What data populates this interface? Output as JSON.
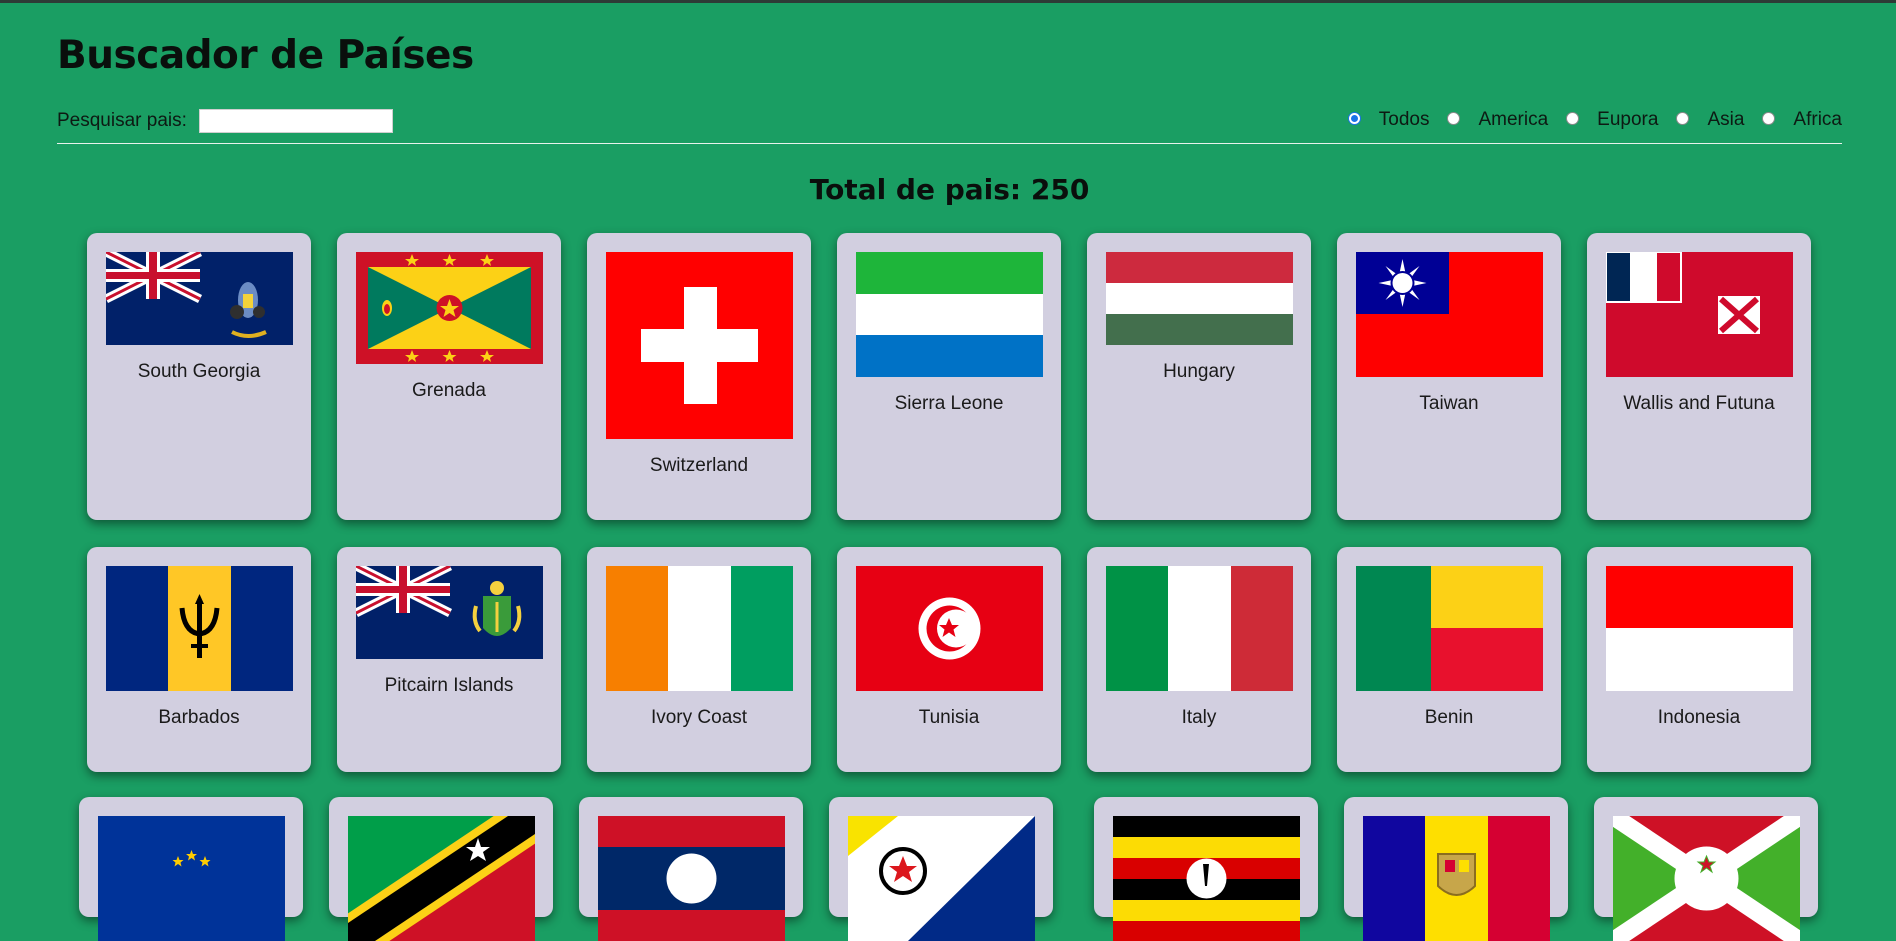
{
  "header": {
    "title": "Buscador de Países"
  },
  "search": {
    "label": "Pesquisar pais:",
    "value": "",
    "placeholder": ""
  },
  "filters": [
    {
      "label": "Todos",
      "checked": true
    },
    {
      "label": "America",
      "checked": false
    },
    {
      "label": "Eupora",
      "checked": false
    },
    {
      "label": "Asia",
      "checked": false
    },
    {
      "label": "Africa",
      "checked": false
    }
  ],
  "total": {
    "text": "Total de pais: 250"
  },
  "countries": [
    {
      "name": "South Georgia",
      "flag": "south-georgia-flag"
    },
    {
      "name": "Grenada",
      "flag": "grenada-flag"
    },
    {
      "name": "Switzerland",
      "flag": "switzerland-flag"
    },
    {
      "name": "Sierra Leone",
      "flag": "sierra-leone-flag"
    },
    {
      "name": "Hungary",
      "flag": "hungary-flag"
    },
    {
      "name": "Taiwan",
      "flag": "taiwan-flag"
    },
    {
      "name": "Wallis and Futuna",
      "flag": "wallis-futuna-flag"
    },
    {
      "name": "Barbados",
      "flag": "barbados-flag"
    },
    {
      "name": "Pitcairn Islands",
      "flag": "pitcairn-flag"
    },
    {
      "name": "Ivory Coast",
      "flag": "ivory-coast-flag"
    },
    {
      "name": "Tunisia",
      "flag": "tunisia-flag"
    },
    {
      "name": "Italy",
      "flag": "italy-flag"
    },
    {
      "name": "Benin",
      "flag": "benin-flag"
    },
    {
      "name": "Indonesia",
      "flag": "indonesia-flag"
    },
    {
      "name": "",
      "flag": "eu-style-flag"
    },
    {
      "name": "",
      "flag": "saint-kitts-nevis-flag"
    },
    {
      "name": "",
      "flag": "laos-flag"
    },
    {
      "name": "",
      "flag": "bonaire-style-flag"
    },
    {
      "name": "",
      "flag": "uganda-flag"
    },
    {
      "name": "",
      "flag": "andorra-flag"
    },
    {
      "name": "",
      "flag": "burundi-flag"
    }
  ],
  "colors": {
    "background": "#1a9e63",
    "card": "#d2cfe0",
    "radio_accent": "#1a73e8"
  }
}
